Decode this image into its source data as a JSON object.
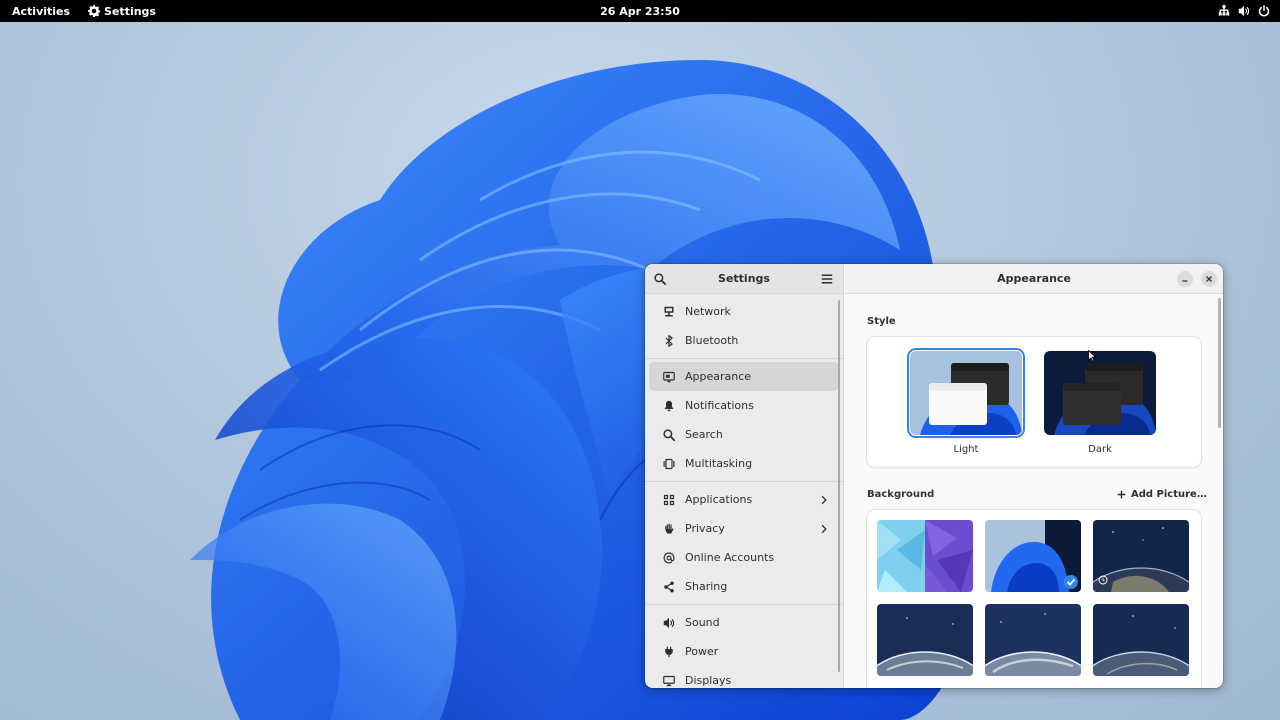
{
  "topbar": {
    "activities": "Activities",
    "app_name": "Settings",
    "clock": "26 Apr  23:50"
  },
  "sidebar": {
    "title": "Settings",
    "groups": [
      [
        {
          "label": "Network",
          "icon": "network-icon"
        },
        {
          "label": "Bluetooth",
          "icon": "bluetooth-icon"
        }
      ],
      [
        {
          "label": "Appearance",
          "icon": "appearance-icon",
          "active": true
        },
        {
          "label": "Notifications",
          "icon": "bell-icon"
        },
        {
          "label": "Search",
          "icon": "search-icon"
        },
        {
          "label": "Multitasking",
          "icon": "multitasking-icon"
        }
      ],
      [
        {
          "label": "Applications",
          "icon": "grid-icon",
          "chevron": true
        },
        {
          "label": "Privacy",
          "icon": "hand-icon",
          "chevron": true
        },
        {
          "label": "Online Accounts",
          "icon": "at-icon"
        },
        {
          "label": "Sharing",
          "icon": "share-icon"
        }
      ],
      [
        {
          "label": "Sound",
          "icon": "speaker-icon"
        },
        {
          "label": "Power",
          "icon": "power-plug-icon"
        },
        {
          "label": "Displays",
          "icon": "display-icon"
        }
      ]
    ]
  },
  "content": {
    "title": "Appearance",
    "style_label": "Style",
    "styles": [
      {
        "label": "Light",
        "selected": true
      },
      {
        "label": "Dark",
        "selected": false
      }
    ],
    "background_label": "Background",
    "add_picture": "Add Picture…"
  },
  "colors": {
    "accent": "#3584e4",
    "topbar": "#000000",
    "sidebar": "#ebebeb"
  }
}
